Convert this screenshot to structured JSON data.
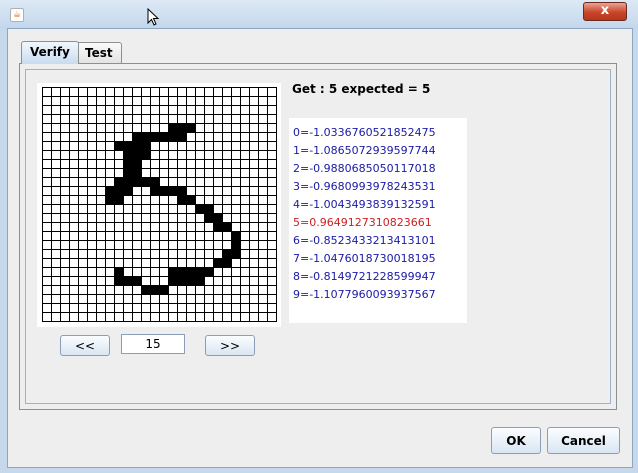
{
  "window": {
    "title": "",
    "close_label": "x"
  },
  "tabs": [
    {
      "label": "Verify",
      "active": true
    },
    {
      "label": "Test",
      "active": false
    }
  ],
  "digit_grid": {
    "size": 26,
    "filled_cells": [
      [
        4,
        14
      ],
      [
        4,
        15
      ],
      [
        4,
        16
      ],
      [
        5,
        10
      ],
      [
        5,
        11
      ],
      [
        5,
        12
      ],
      [
        5,
        13
      ],
      [
        5,
        14
      ],
      [
        5,
        15
      ],
      [
        6,
        8
      ],
      [
        6,
        9
      ],
      [
        6,
        10
      ],
      [
        6,
        11
      ],
      [
        7,
        9
      ],
      [
        7,
        10
      ],
      [
        7,
        11
      ],
      [
        8,
        9
      ],
      [
        8,
        10
      ],
      [
        9,
        9
      ],
      [
        9,
        10
      ],
      [
        10,
        8
      ],
      [
        10,
        9
      ],
      [
        10,
        10
      ],
      [
        10,
        11
      ],
      [
        10,
        12
      ],
      [
        11,
        7
      ],
      [
        11,
        8
      ],
      [
        11,
        9
      ],
      [
        11,
        12
      ],
      [
        11,
        13
      ],
      [
        11,
        14
      ],
      [
        11,
        15
      ],
      [
        12,
        7
      ],
      [
        12,
        8
      ],
      [
        12,
        15
      ],
      [
        12,
        16
      ],
      [
        13,
        17
      ],
      [
        13,
        18
      ],
      [
        14,
        18
      ],
      [
        14,
        19
      ],
      [
        15,
        19
      ],
      [
        15,
        20
      ],
      [
        16,
        21
      ],
      [
        17,
        21
      ],
      [
        18,
        20
      ],
      [
        18,
        21
      ],
      [
        19,
        19
      ],
      [
        19,
        20
      ],
      [
        20,
        8
      ],
      [
        20,
        14
      ],
      [
        20,
        15
      ],
      [
        20,
        16
      ],
      [
        20,
        17
      ],
      [
        20,
        18
      ],
      [
        21,
        8
      ],
      [
        21,
        9
      ],
      [
        21,
        10
      ],
      [
        21,
        14
      ],
      [
        21,
        15
      ],
      [
        21,
        16
      ],
      [
        21,
        17
      ],
      [
        22,
        11
      ],
      [
        22,
        12
      ],
      [
        22,
        13
      ]
    ]
  },
  "navigation": {
    "prev_label": "<<",
    "next_label": ">>",
    "index_value": "15"
  },
  "result": {
    "summary": "Get : 5 expected = 5",
    "scores": [
      "0=-1.0336760521852475",
      "1=-1.0865072939597744",
      "2=-0.9880685050117018",
      "3=-0.9680993978243531",
      "4=-1.0043493839132591",
      "5=0.9649127310823661",
      "6=-0.8523433213413101",
      "7=-1.0476018730018195",
      "8=-0.8149721228599947",
      "9=-1.1077960093937567"
    ],
    "best_index": 5
  },
  "dialog_buttons": {
    "ok_label": "OK",
    "cancel_label": "Cancel"
  },
  "colors": {
    "score_text": "#1a1aa6",
    "best_score_text": "#cc1f1f"
  }
}
